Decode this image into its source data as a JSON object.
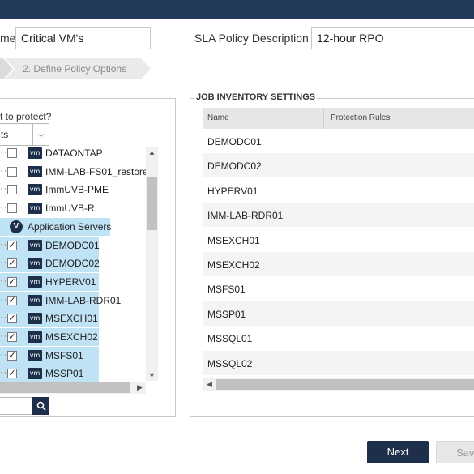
{
  "header": {
    "bar_color": "#243a5b"
  },
  "form": {
    "name_label_fragment": "me",
    "name_value": "Critical VM's",
    "description_label": "SLA Policy Description",
    "description_value": "12-hour RPO"
  },
  "wizard": {
    "step2_label": "2. Define Policy Options"
  },
  "left": {
    "question": "t to protect?",
    "dropdown_value": "ts",
    "tree": [
      {
        "name": "DATAONTAP",
        "type": "vm",
        "checked": false,
        "selected": false
      },
      {
        "name": "IMM-LAB-FS01_restore",
        "type": "vm",
        "checked": false,
        "selected": false
      },
      {
        "name": "ImmUVB-PME",
        "type": "vm",
        "checked": false,
        "selected": false
      },
      {
        "name": "ImmUVB-R",
        "type": "vm",
        "checked": false,
        "selected": false
      },
      {
        "name": "Application Servers",
        "type": "group",
        "checked": null,
        "selected": true
      },
      {
        "name": "DEMODC01",
        "type": "vm",
        "checked": true,
        "selected": true
      },
      {
        "name": "DEMODC02",
        "type": "vm",
        "checked": true,
        "selected": true
      },
      {
        "name": "HYPERV01",
        "type": "vm",
        "checked": true,
        "selected": true
      },
      {
        "name": "IMM-LAB-RDR01",
        "type": "vm",
        "checked": true,
        "selected": true
      },
      {
        "name": "MSEXCH01",
        "type": "vm",
        "checked": true,
        "selected": true
      },
      {
        "name": "MSEXCH02",
        "type": "vm",
        "checked": true,
        "selected": true
      },
      {
        "name": "MSFS01",
        "type": "vm",
        "checked": true,
        "selected": true
      },
      {
        "name": "MSSP01",
        "type": "vm",
        "checked": true,
        "selected": true
      }
    ],
    "vm_badge": "vm",
    "group_badge": "V"
  },
  "inventory": {
    "title": "JOB INVENTORY SETTINGS",
    "columns": [
      "Name",
      "Protection Rules"
    ],
    "rows": [
      "DEMODC01",
      "DEMODC02",
      "HYPERV01",
      "IMM-LAB-RDR01",
      "MSEXCH01",
      "MSEXCH02",
      "MSFS01",
      "MSSP01",
      "MSSQL01",
      "MSSQL02"
    ]
  },
  "footer": {
    "next_label": "Next",
    "save_label": "Save"
  },
  "colors": {
    "accent": "#1d2f4a",
    "selection": "#bfe2f5"
  }
}
